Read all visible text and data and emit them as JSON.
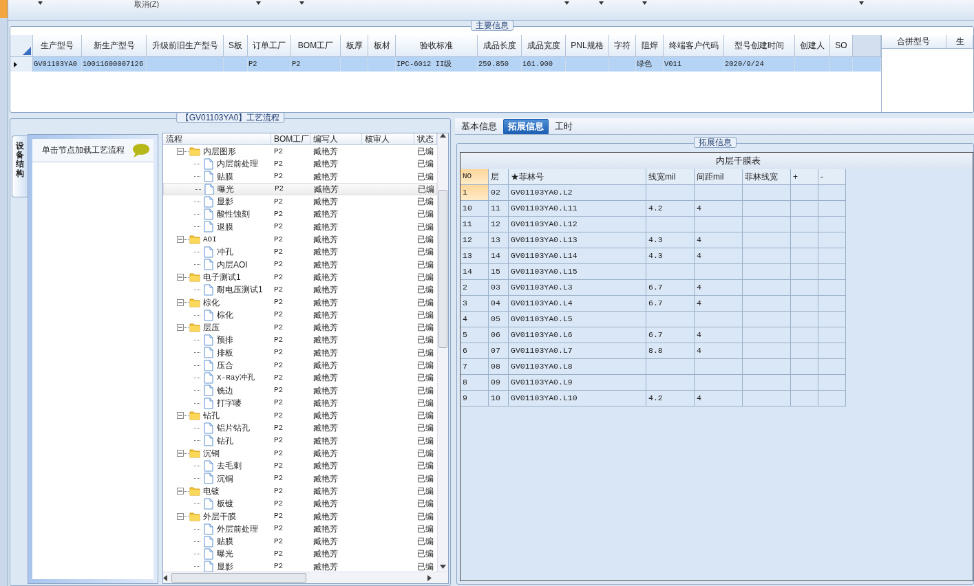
{
  "toolbar": {
    "cancel_label": "取消(Z)"
  },
  "main_info": {
    "title": "主要信息",
    "columns": [
      "生产型号",
      "新生产型号",
      "升级前旧生产型号",
      "S板",
      "订单工厂",
      "BOM工厂",
      "板厚",
      "板材",
      "验收标准",
      "成品长度",
      "成品宽度",
      "PNL规格",
      "字符",
      "阻焊",
      "终端客户代码",
      "型号创建时间",
      "创建人",
      "SO"
    ],
    "rows": [
      {
        "selected": true,
        "cells": [
          "GV01103YA0",
          "10011600007126",
          null,
          null,
          "P2",
          "P2",
          null,
          null,
          "IPC-6012 II级",
          "259.850",
          "161.900",
          null,
          null,
          "绿色",
          "V011",
          "2020/9/24",
          null,
          null
        ]
      }
    ],
    "side_columns": [
      "合拼型号",
      "生"
    ]
  },
  "process": {
    "title": "【GV01103YA0】工艺流程",
    "side_tab": "设备结构",
    "hint": "单击节点加载工艺流程",
    "columns": [
      "流程",
      "BOM工厂",
      "编写人",
      "核审人",
      "状态"
    ],
    "tree": [
      {
        "name": "内层图形",
        "bom": "P2",
        "author": "臧艳芳",
        "status": "已编",
        "expanded": true,
        "selected": false,
        "children": [
          {
            "name": "内层前处理",
            "bom": "P2",
            "author": "臧艳芳",
            "status": "已编",
            "selected": false
          },
          {
            "name": "贴膜",
            "bom": "P2",
            "author": "臧艳芳",
            "status": "已编",
            "selected": false
          },
          {
            "name": "曝光",
            "bom": "P2",
            "author": "臧艳芳",
            "status": "已编",
            "selected": true
          },
          {
            "name": "显影",
            "bom": "P2",
            "author": "臧艳芳",
            "status": "已编",
            "selected": false
          },
          {
            "name": "酸性蚀刻",
            "bom": "P2",
            "author": "臧艳芳",
            "status": "已编",
            "selected": false
          },
          {
            "name": "退膜",
            "bom": "P2",
            "author": "臧艳芳",
            "status": "已编",
            "selected": false
          }
        ]
      },
      {
        "name": "AOI",
        "bom": "P2",
        "author": "臧艳芳",
        "status": "已编",
        "expanded": true,
        "selected": false,
        "children": [
          {
            "name": "冲孔",
            "bom": "P2",
            "author": "臧艳芳",
            "status": "已编",
            "selected": false
          },
          {
            "name": "内层AOI",
            "bom": "P2",
            "author": "臧艳芳",
            "status": "已编",
            "selected": false
          }
        ]
      },
      {
        "name": "电子测试1",
        "bom": "P2",
        "author": "臧艳芳",
        "status": "已编",
        "expanded": true,
        "selected": false,
        "children": [
          {
            "name": "耐电压测试1",
            "bom": "P2",
            "author": "臧艳芳",
            "status": "已编",
            "selected": false
          }
        ]
      },
      {
        "name": "棕化",
        "bom": "P2",
        "author": "臧艳芳",
        "status": "已编",
        "expanded": true,
        "selected": false,
        "children": [
          {
            "name": "棕化",
            "bom": "P2",
            "author": "臧艳芳",
            "status": "已编",
            "selected": false
          }
        ]
      },
      {
        "name": "层压",
        "bom": "P2",
        "author": "臧艳芳",
        "status": "已编",
        "expanded": true,
        "selected": false,
        "children": [
          {
            "name": "预排",
            "bom": "P2",
            "author": "臧艳芳",
            "status": "已编",
            "selected": false
          },
          {
            "name": "排板",
            "bom": "P2",
            "author": "臧艳芳",
            "status": "已编",
            "selected": false
          },
          {
            "name": "压合",
            "bom": "P2",
            "author": "臧艳芳",
            "status": "已编",
            "selected": false
          },
          {
            "name": "X-Ray冲孔",
            "bom": "P2",
            "author": "臧艳芳",
            "status": "已编",
            "selected": false
          },
          {
            "name": "铣边",
            "bom": "P2",
            "author": "臧艳芳",
            "status": "已编",
            "selected": false
          },
          {
            "name": "打字嘜",
            "bom": "P2",
            "author": "臧艳芳",
            "status": "已编",
            "selected": false
          }
        ]
      },
      {
        "name": "钻孔",
        "bom": "P2",
        "author": "臧艳芳",
        "status": "已编",
        "expanded": true,
        "selected": false,
        "children": [
          {
            "name": "铝片钻孔",
            "bom": "P2",
            "author": "臧艳芳",
            "status": "已编",
            "selected": false
          },
          {
            "name": "钻孔",
            "bom": "P2",
            "author": "臧艳芳",
            "status": "已编",
            "selected": false
          }
        ]
      },
      {
        "name": "沉铜",
        "bom": "P2",
        "author": "臧艳芳",
        "status": "已编",
        "expanded": true,
        "selected": false,
        "children": [
          {
            "name": "去毛刺",
            "bom": "P2",
            "author": "臧艳芳",
            "status": "已编",
            "selected": false
          },
          {
            "name": "沉铜",
            "bom": "P2",
            "author": "臧艳芳",
            "status": "已编",
            "selected": false
          }
        ]
      },
      {
        "name": "电镀",
        "bom": "P2",
        "author": "臧艳芳",
        "status": "已编",
        "expanded": true,
        "selected": false,
        "children": [
          {
            "name": "板镀",
            "bom": "P2",
            "author": "臧艳芳",
            "status": "已编",
            "selected": false
          }
        ]
      },
      {
        "name": "外层干膜",
        "bom": "P2",
        "author": "臧艳芳",
        "status": "已编",
        "expanded": true,
        "selected": false,
        "children": [
          {
            "name": "外层前处理",
            "bom": "P2",
            "author": "臧艳芳",
            "status": "已编",
            "selected": false
          },
          {
            "name": "贴膜",
            "bom": "P2",
            "author": "臧艳芳",
            "status": "已编",
            "selected": false
          },
          {
            "name": "曝光",
            "bom": "P2",
            "author": "臧艳芳",
            "status": "已编",
            "selected": false
          },
          {
            "name": "显影",
            "bom": "P2",
            "author": "臧艳芳",
            "status": "已编",
            "selected": false
          }
        ]
      }
    ]
  },
  "detail": {
    "tabs": [
      {
        "label": "基本信息",
        "selected": false
      },
      {
        "label": "拓展信息",
        "selected": true
      },
      {
        "label": "工时",
        "selected": false
      }
    ],
    "group_title": "拓展信息",
    "table": {
      "caption": "内层干膜表",
      "columns": [
        "NO",
        "层",
        "★菲林号",
        "线宽mil",
        "间距mil",
        "菲林线宽",
        "+",
        "-"
      ],
      "rows": [
        {
          "selected": true,
          "cells": [
            "1",
            "02",
            "GV01103YA0.L2"
          ]
        },
        {
          "selected": false,
          "cells": [
            "10",
            "11",
            "GV01103YA0.L11",
            "4.2",
            "4"
          ]
        },
        {
          "selected": false,
          "cells": [
            "11",
            "12",
            "GV01103YA0.L12"
          ]
        },
        {
          "selected": false,
          "cells": [
            "12",
            "13",
            "GV01103YA0.L13",
            "4.3",
            "4"
          ]
        },
        {
          "selected": false,
          "cells": [
            "13",
            "14",
            "GV01103YA0.L14",
            "4.3",
            "4"
          ]
        },
        {
          "selected": false,
          "cells": [
            "14",
            "15",
            "GV01103YA0.L15"
          ]
        },
        {
          "selected": false,
          "cells": [
            "2",
            "03",
            "GV01103YA0.L3",
            "6.7",
            "4"
          ]
        },
        {
          "selected": false,
          "cells": [
            "3",
            "04",
            "GV01103YA0.L4",
            "6.7",
            "4"
          ]
        },
        {
          "selected": false,
          "cells": [
            "4",
            "05",
            "GV01103YA0.L5"
          ]
        },
        {
          "selected": false,
          "cells": [
            "5",
            "06",
            "GV01103YA0.L6",
            "6.7",
            "4"
          ]
        },
        {
          "selected": false,
          "cells": [
            "6",
            "07",
            "GV01103YA0.L7",
            "8.8",
            "4"
          ]
        },
        {
          "selected": false,
          "cells": [
            "7",
            "08",
            "GV01103YA0.L8"
          ]
        },
        {
          "selected": false,
          "cells": [
            "8",
            "09",
            "GV01103YA0.L9"
          ]
        },
        {
          "selected": false,
          "cells": [
            "9",
            "10",
            "GV01103YA0.L10",
            "4.2",
            "4"
          ]
        }
      ]
    }
  }
}
